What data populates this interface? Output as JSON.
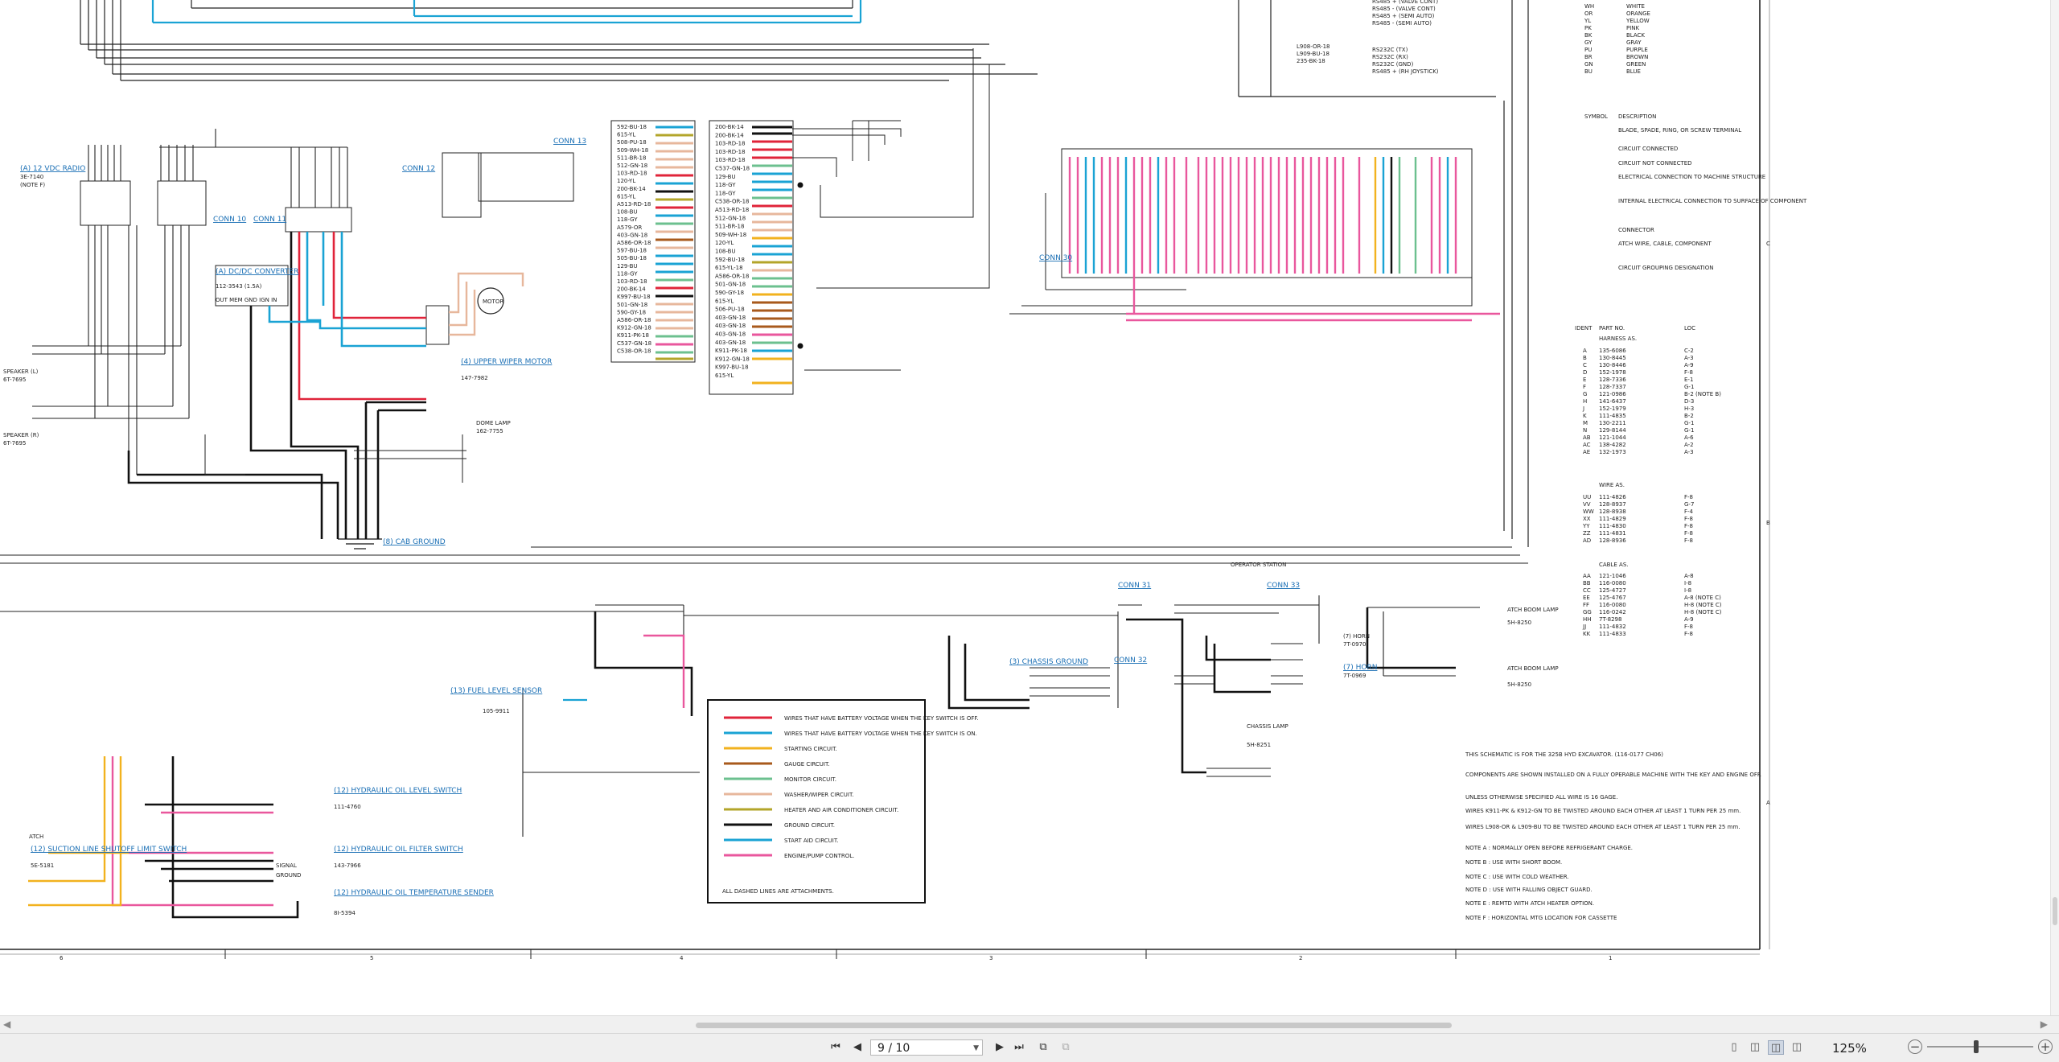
{
  "legend": {
    "items": [
      {
        "color": "#e0243a",
        "text": "WIRES THAT HAVE BATTERY VOLTAGE WHEN THE KEY SWITCH IS OFF."
      },
      {
        "color": "#1aa3d4",
        "text": "WIRES THAT HAVE BATTERY VOLTAGE WHEN THE KEY SWITCH IS ON."
      },
      {
        "color": "#f2b21e",
        "text": "STARTING CIRCUIT."
      },
      {
        "color": "#a85a1c",
        "text": "GAUGE CIRCUIT."
      },
      {
        "color": "#6cc08f",
        "text": "MONITOR CIRCUIT."
      },
      {
        "color": "#e7b79c",
        "text": "WASHER/WIPER CIRCUIT."
      },
      {
        "color": "#b3a52a",
        "text": "HEATER AND AIR CONDITIONER CIRCUIT."
      },
      {
        "color": "#111111",
        "text": "GROUND CIRCUIT."
      },
      {
        "color": "#1aa3d4",
        "text": "START AID CIRCUIT."
      },
      {
        "color": "#e9579d",
        "text": "ENGINE/PUMP CONTROL."
      }
    ],
    "footer": "ALL DASHED LINES ARE ATTACHMENTS."
  },
  "color_codes": [
    {
      "code": "WH",
      "name": "WHITE"
    },
    {
      "code": "OR",
      "name": "ORANGE"
    },
    {
      "code": "YL",
      "name": "YELLOW"
    },
    {
      "code": "PK",
      "name": "PINK"
    },
    {
      "code": "BK",
      "name": "BLACK"
    },
    {
      "code": "GY",
      "name": "GRAY"
    },
    {
      "code": "PU",
      "name": "PURPLE"
    },
    {
      "code": "BR",
      "name": "BROWN"
    },
    {
      "code": "GN",
      "name": "GREEN"
    },
    {
      "code": "BU",
      "name": "BLUE"
    }
  ],
  "symbols_header": {
    "symbol": "SYMBOL",
    "description": "DESCRIPTION"
  },
  "symbols": [
    "BLADE, SPADE, RING, OR SCREW TERMINAL",
    "CIRCUIT CONNECTED",
    "CIRCUIT NOT CONNECTED",
    "ELECTRICAL CONNECTION TO MACHINE STRUCTURE",
    "INTERNAL ELECTRICAL CONNECTION TO SURFACE OF COMPONENT",
    "CONNECTOR",
    "ATCH WIRE, CABLE, COMPONENT",
    "CIRCUIT GROUPING DESIGNATION"
  ],
  "harness_header": {
    "ident": "IDENT",
    "part": "PART NO.",
    "loc": "LOC",
    "title": "HARNESS AS."
  },
  "harness": [
    [
      "A",
      "135-6086",
      "C-2"
    ],
    [
      "B",
      "130-8445",
      "A-3"
    ],
    [
      "C",
      "130-8446",
      "A-9"
    ],
    [
      "D",
      "152-1978",
      "F-8"
    ],
    [
      "E",
      "128-7336",
      "E-1"
    ],
    [
      "F",
      "128-7337",
      "G-1"
    ],
    [
      "G",
      "121-0986",
      "B-2 (NOTE B)"
    ],
    [
      "H",
      "141-6437",
      "D-3"
    ],
    [
      "J",
      "152-1979",
      "H-3"
    ],
    [
      "K",
      "111-4835",
      "B-2"
    ],
    [
      "M",
      "130-2211",
      "G-1"
    ],
    [
      "N",
      "129-8144",
      "G-1"
    ],
    [
      "AB",
      "121-1044",
      "A-6"
    ],
    [
      "AC",
      "138-4282",
      "A-2"
    ],
    [
      "AE",
      "132-1973",
      "A-3"
    ]
  ],
  "wire_title": "WIRE AS.",
  "wire_as": [
    [
      "UU",
      "111-4826",
      "F-8"
    ],
    [
      "VV",
      "128-8937",
      "G-7"
    ],
    [
      "WW",
      "128-8938",
      "F-4"
    ],
    [
      "XX",
      "111-4829",
      "F-8"
    ],
    [
      "YY",
      "111-4830",
      "F-8"
    ],
    [
      "ZZ",
      "111-4831",
      "F-8"
    ],
    [
      "AD",
      "128-8936",
      "F-8"
    ]
  ],
  "cable_title": "CABLE AS.",
  "cable_as": [
    [
      "AA",
      "121-1046",
      "A-8"
    ],
    [
      "BB",
      "116-0080",
      "I-8"
    ],
    [
      "CC",
      "125-4727",
      "I-8"
    ],
    [
      "EE",
      "125-4767",
      "A-8 (NOTE C)"
    ],
    [
      "FF",
      "116-0080",
      "H-8 (NOTE C)"
    ],
    [
      "GG",
      "116-0242",
      "H-8 (NOTE C)"
    ],
    [
      "HH",
      "7T-8298",
      "A-9"
    ],
    [
      "JJ",
      "111-4832",
      "F-8"
    ],
    [
      "KK",
      "111-4833",
      "F-8"
    ]
  ],
  "notes": [
    "THIS SCHEMATIC IS FOR THE 325B HYD EXCAVATOR. (116-0177 CH06)",
    "COMPONENTS ARE SHOWN INSTALLED ON A FULLY OPERABLE MACHINE WITH THE KEY AND ENGINE OFF.",
    "UNLESS OTHERWISE SPECIFIED ALL WIRE IS 16 GAGE.",
    "WIRES K911-PK & K912-GN TO BE TWISTED AROUND EACH OTHER AT LEAST 1 TURN PER 25 mm.",
    "WIRES L908-OR & L909-BU TO BE TWISTED AROUND EACH OTHER AT LEAST 1 TURN PER 25 mm.",
    "NOTE A : NORMALLY OPEN BEFORE REFRIGERANT CHARGE.",
    "NOTE B : USE WITH SHORT BOOM.",
    "NOTE C : USE WITH COLD WEATHER.",
    "NOTE D : USE WITH FALLING OBJECT GUARD.",
    "NOTE E : REMTD WITH ATCH HEATER OPTION.",
    "NOTE F : HORIZONTAL MTG LOCATION FOR CASSETTE"
  ],
  "top_right_signals": [
    "RS485 + (VALVE CONT)",
    "RS485 - (VALVE CONT)",
    "RS485 + (SEMI AUTO)",
    "RS485 - (SEMI AUTO)",
    "RS232C (TX)",
    "RS232C (RX)",
    "RS232C (GND)",
    "RS485 + (RH JOYSTICK)"
  ],
  "top_right_wires": [
    "L908-OR-18",
    "L909-BU-18",
    "235-BK-18"
  ],
  "components": {
    "radio": "(A) 12 VDC RADIO",
    "radio_part": "3E-7140",
    "radio_note": "(NOTE F)",
    "converter": "(A) DC/DC CONVERTER",
    "converter_part": "112-3543 (1.5A)",
    "converter_pins": "OUT MEM GND IGN IN",
    "motor": "MOTOR",
    "wiper": "(4) UPPER WIPER MOTOR",
    "wiper_part": "147-7982",
    "dome": "DOME LAMP",
    "dome_part": "162-7755",
    "cab_ground": "(8) CAB GROUND",
    "speaker_l": "SPEAKER (L)",
    "speaker_l_part": "6T-7695",
    "speaker_r": "SPEAKER (R)",
    "speaker_r_part": "6T-7695",
    "fuel": "(13) FUEL LEVEL SENSOR",
    "fuel_part": "105-9911",
    "horn": "(7) HORN",
    "horn_part": "7T-0970",
    "horn2": "(7) HORN",
    "horn2_part": "7T-0969",
    "boom1": "ATCH BOOM LAMP",
    "boom1_part": "5H-8250",
    "boom2": "ATCH BOOM LAMP",
    "boom2_part": "5H-8250",
    "chassis": "CHASSIS LAMP",
    "chassis_part": "5H-8251",
    "chassis_ground": "(3) CHASSIS GROUND",
    "hyd_level": "(12) HYDRAULIC OIL LEVEL SWITCH",
    "hyd_level_part": "111-4760",
    "hyd_filter": "(12) HYDRAULIC OIL FILTER SWITCH",
    "hyd_filter_part": "143-7966",
    "hyd_temp": "(12) HYDRAULIC OIL TEMPERATURE SENDER",
    "hyd_temp_part": "8I-5394",
    "suction": "(12) SUCTION LINE SHUTOFF LIMIT SWITCH",
    "suction_part": "5E-5181",
    "atch": "ATCH",
    "operator_station": "OPERATOR STATION",
    "signal": "SIGNAL",
    "ground": "GROUND"
  },
  "connectors": [
    "CONN 10",
    "CONN 11",
    "CONN 12",
    "CONN 13",
    "CONN 31",
    "CONN 32",
    "CONN 33",
    "CONN 30"
  ],
  "column_numbers": [
    "6",
    "5",
    "4",
    "3",
    "2",
    "1"
  ],
  "row_letters": [
    "C",
    "B",
    "A"
  ],
  "wire_list_a": [
    "592-BU-18",
    "615-YL",
    "508-PU-18",
    "509-WH-18",
    "511-BR-18",
    "512-GN-18",
    "103-RD-18",
    "120-YL",
    "200-BK-14",
    "615-YL",
    "A513-RD-18",
    "108-BU",
    "118-GY",
    "A579-OR",
    "403-GN-18",
    "A586-OR-18",
    "597-BU-18",
    "505-BU-18",
    "129-BU",
    "118-GY",
    "103-RD-18",
    "200-BK-14",
    "K997-BU-18",
    "501-GN-18",
    "590-GY-18",
    "A586-OR-18",
    "K912-GN-18",
    "K911-PK-18",
    "C537-GN-18",
    "C538-OR-18"
  ],
  "wire_list_b": [
    "200-BK-14",
    "200-BK-14",
    "103-RD-18",
    "103-RD-18",
    "103-RD-18",
    "C537-GN-18",
    "129-BU",
    "118-GY",
    "118-GY",
    "C538-OR-18",
    "A513-RD-18",
    "512-GN-18",
    "511-BR-18",
    "509-WH-18",
    "120-YL",
    "108-BU",
    "592-BU-18",
    "615-YL-18",
    "A586-OR-18",
    "501-GN-18",
    "590-GY-18",
    "615-YL",
    "506-PU-18",
    "403-GN-18",
    "403-GN-18",
    "403-GN-18",
    "403-GN-18",
    "K911-PK-18",
    "K912-GN-18",
    "K997-BU-18",
    "615-YL"
  ],
  "status": {
    "page": "9 / 10",
    "zoom": "125%"
  }
}
